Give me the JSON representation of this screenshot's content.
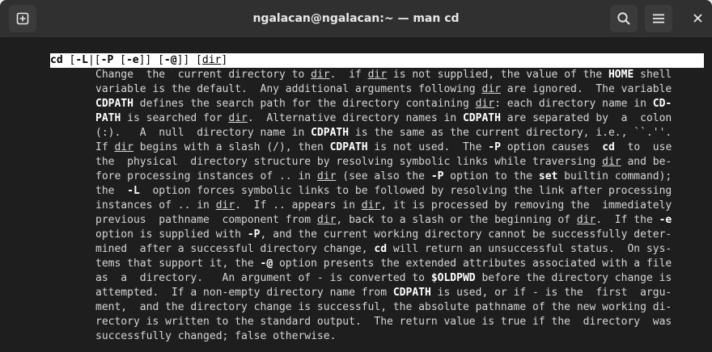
{
  "window": {
    "title": "ngalacan@ngalacan:~ — man cd",
    "new_tab_icon": "new-tab-icon",
    "search_icon": "search-icon",
    "menu_icon": "hamburger-menu-icon",
    "close_icon": "close-icon"
  },
  "background": {
    "glyph": "r"
  },
  "man": {
    "synopsis": "cd [-L|[-P [-e]] [-@]] [dir]",
    "lines": [
      "Change  the  current directory to dir.  if dir is not supplied, the value of the HOME shell",
      "variable is the default.  Any additional arguments following dir are ignored.  The variable",
      "CDPATH defines the search path for the directory containing dir: each directory name in CD‐",
      "PATH is searched for dir.  Alternative directory names in CDPATH are separated by  a  colon",
      "(:).   A  null  directory name in CDPATH is the same as the current directory, i.e., ``.''.",
      "If dir begins with a slash (/), then CDPATH is not used.  The -P option causes  cd  to  use",
      "the  physical  directory structure by resolving symbolic links while traversing dir and be‐",
      "fore processing instances of .. in dir (see also the -P option to the set builtin command);",
      "the  -L  option forces symbolic links to be followed by resolving the link after processing",
      "instances of .. in dir.  If .. appears in dir, it is processed by removing the  immediately",
      "previous  pathname  component from dir, back to a slash or the beginning of dir.  If the -e",
      "option is supplied with -P, and the current working directory cannot be successfully deter‐",
      "mined  after a successful directory change, cd will return an unsuccessful status.  On sys‐",
      "tems that support it, the -@ option presents the extended attributes associated with a file",
      "as  a  directory.   An argument of - is converted to $OLDPWD before the directory change is",
      "attempted.  If a non-empty directory name from CDPATH is used, or if - is the  first  argu‐",
      "ment,  and the directory change is successful, the absolute pathname of the new working di‐",
      "rectory is written to the standard output.  The return value is true if the  directory  was",
      "successfully changed; false otherwise."
    ]
  }
}
